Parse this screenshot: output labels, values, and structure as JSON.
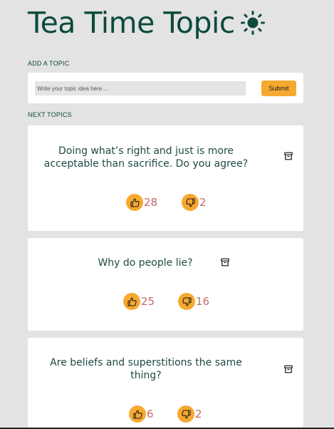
{
  "app": {
    "title": "Tea Time Topic",
    "theme_icon": "sun-icon"
  },
  "add_topic": {
    "label": "ADD A TOPIC",
    "placeholder": "Write your topic idea here....",
    "value": "",
    "submit_label": "Submit"
  },
  "next_topics": {
    "label": "NEXT TOPICS",
    "topics": [
      {
        "text": "Doing what’s right and just is more acceptable than sacrifice. Do you agree?",
        "upvotes": "28",
        "downvotes": "2"
      },
      {
        "text": "Why do people lie?",
        "upvotes": "25",
        "downvotes": "16"
      },
      {
        "text": "Are beliefs and superstitions the same thing?",
        "upvotes": "6",
        "downvotes": "2"
      }
    ]
  },
  "colors": {
    "accent": "#f6a930",
    "title": "#0b4a3c",
    "count": "#c06a6a",
    "background": "#e3e3e3"
  }
}
